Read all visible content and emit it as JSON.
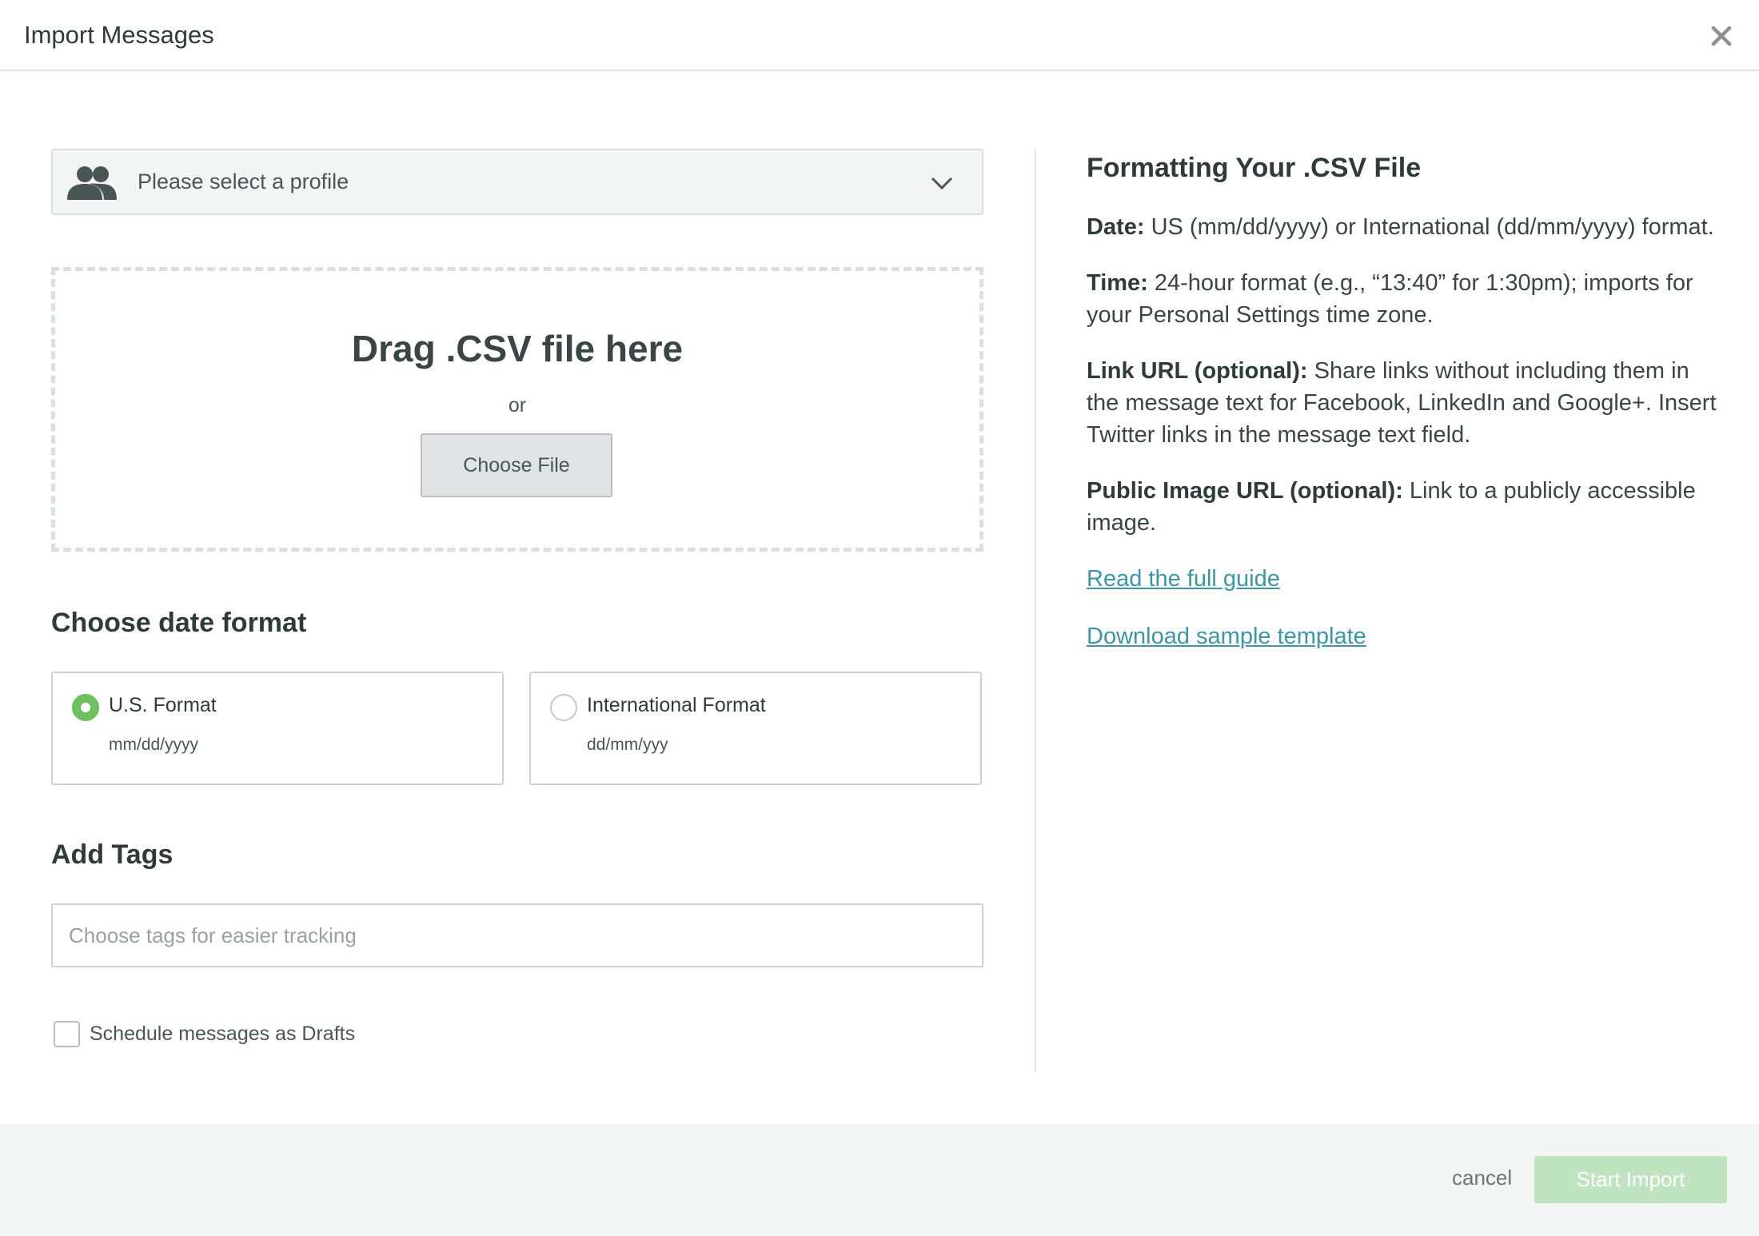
{
  "header": {
    "title": "Import Messages",
    "close_icon": "close-icon"
  },
  "profile": {
    "placeholder": "Please select a profile",
    "icon": "users-icon"
  },
  "dropzone": {
    "title": "Drag .CSV file here",
    "or": "or",
    "choose_file": "Choose File"
  },
  "date_format": {
    "title": "Choose date format",
    "options": [
      {
        "label": "U.S. Format",
        "format": "mm/dd/yyyy",
        "selected": true
      },
      {
        "label": "International Format",
        "format": "dd/mm/yyy",
        "selected": false
      }
    ]
  },
  "tags": {
    "title": "Add Tags",
    "placeholder": "Choose tags for easier tracking",
    "value": ""
  },
  "drafts": {
    "label": "Schedule messages as Drafts",
    "checked": false
  },
  "info": {
    "title": "Formatting Your .CSV File",
    "items": [
      {
        "label": "Date:",
        "text": "US (mm/dd/yyyy) or International (dd/mm/yyyy) format."
      },
      {
        "label": "Time:",
        "text": "24-hour format (e.g., “13:40” for 1:30pm); imports for your Personal Settings time zone."
      },
      {
        "label": "Link URL (optional):",
        "text": "Share links without including them in the message text for Facebook, LinkedIn and Google+. Insert Twitter links in the message text field."
      },
      {
        "label": "Public Image URL (optional):",
        "text": "Link to a publicly accessible image."
      }
    ],
    "links": [
      "Read the full guide",
      "Download sample template"
    ]
  },
  "footer": {
    "cancel": "cancel",
    "start": "Start Import"
  },
  "colors": {
    "accent": "#6cc05e",
    "link": "#3b97a5",
    "start_disabled": "#bfe4bf"
  }
}
